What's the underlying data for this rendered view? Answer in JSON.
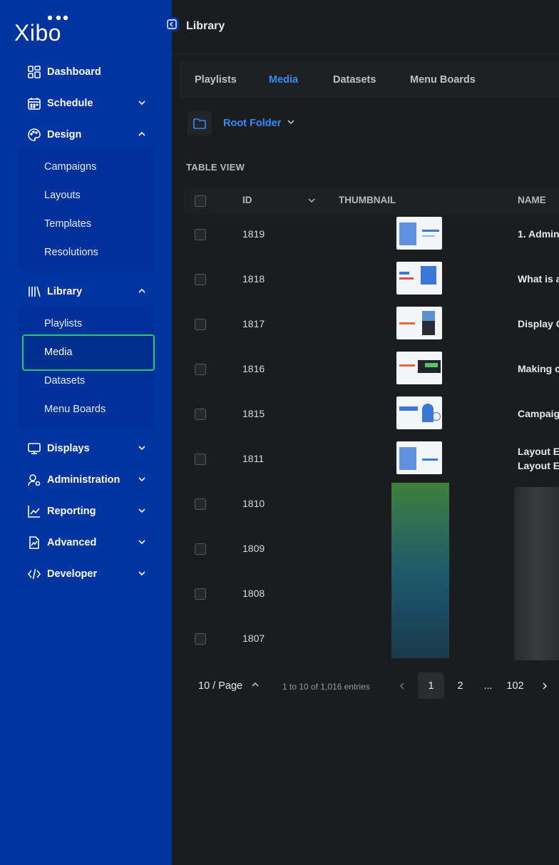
{
  "app": {
    "logo_text": "Xibo",
    "page_title": "Library"
  },
  "sidebar": {
    "items": [
      {
        "label": "Dashboard",
        "icon": "dashboard-icon"
      },
      {
        "label": "Schedule",
        "icon": "calendar-icon"
      },
      {
        "label": "Design",
        "icon": "palette-icon"
      },
      {
        "label": "Library",
        "icon": "library-icon"
      },
      {
        "label": "Displays",
        "icon": "monitor-icon"
      },
      {
        "label": "Administration",
        "icon": "user-gear-icon"
      },
      {
        "label": "Reporting",
        "icon": "chart-icon"
      },
      {
        "label": "Advanced",
        "icon": "advanced-icon"
      },
      {
        "label": "Developer",
        "icon": "code-icon"
      }
    ],
    "design_sub": [
      "Campaigns",
      "Layouts",
      "Templates",
      "Resolutions"
    ],
    "library_sub": [
      "Playlists",
      "Media",
      "Datasets",
      "Menu Boards"
    ],
    "active_item": "Media"
  },
  "tabs": [
    {
      "label": "Playlists",
      "active": false
    },
    {
      "label": "Media",
      "active": true
    },
    {
      "label": "Datasets",
      "active": false
    },
    {
      "label": "Menu Boards",
      "active": false
    }
  ],
  "folder": {
    "label": "Root Folder"
  },
  "table": {
    "view_label": "TABLE VIEW",
    "headers": {
      "id": "ID",
      "thumbnail": "THUMBNAIL",
      "name": "NAME"
    },
    "rows": [
      {
        "id": "1819",
        "name": "1. Admin",
        "has_thumb": true
      },
      {
        "id": "1818",
        "name": "What is a",
        "has_thumb": true
      },
      {
        "id": "1817",
        "name": "Display C",
        "has_thumb": true
      },
      {
        "id": "1816",
        "name": "Making c",
        "has_thumb": true
      },
      {
        "id": "1815",
        "name": "Campaig",
        "has_thumb": true
      },
      {
        "id": "1811",
        "name": "Layout E",
        "name2": "Layout E",
        "has_thumb": true
      },
      {
        "id": "1810",
        "name": "",
        "has_thumb": false
      },
      {
        "id": "1809",
        "name": "",
        "has_thumb": false
      },
      {
        "id": "1808",
        "name": "",
        "has_thumb": false
      },
      {
        "id": "1807",
        "name": "",
        "has_thumb": false
      }
    ]
  },
  "pagination": {
    "per_page": "10 / Page",
    "summary": "1 to 10 of 1,016 entries",
    "pages": [
      "1",
      "2",
      "...",
      "102"
    ],
    "current": "1"
  },
  "colors": {
    "sidebar_bg": "#0034a0",
    "accent": "#2d8cff",
    "active_outline": "#22cc6e",
    "main_bg": "#1b1c1e"
  }
}
